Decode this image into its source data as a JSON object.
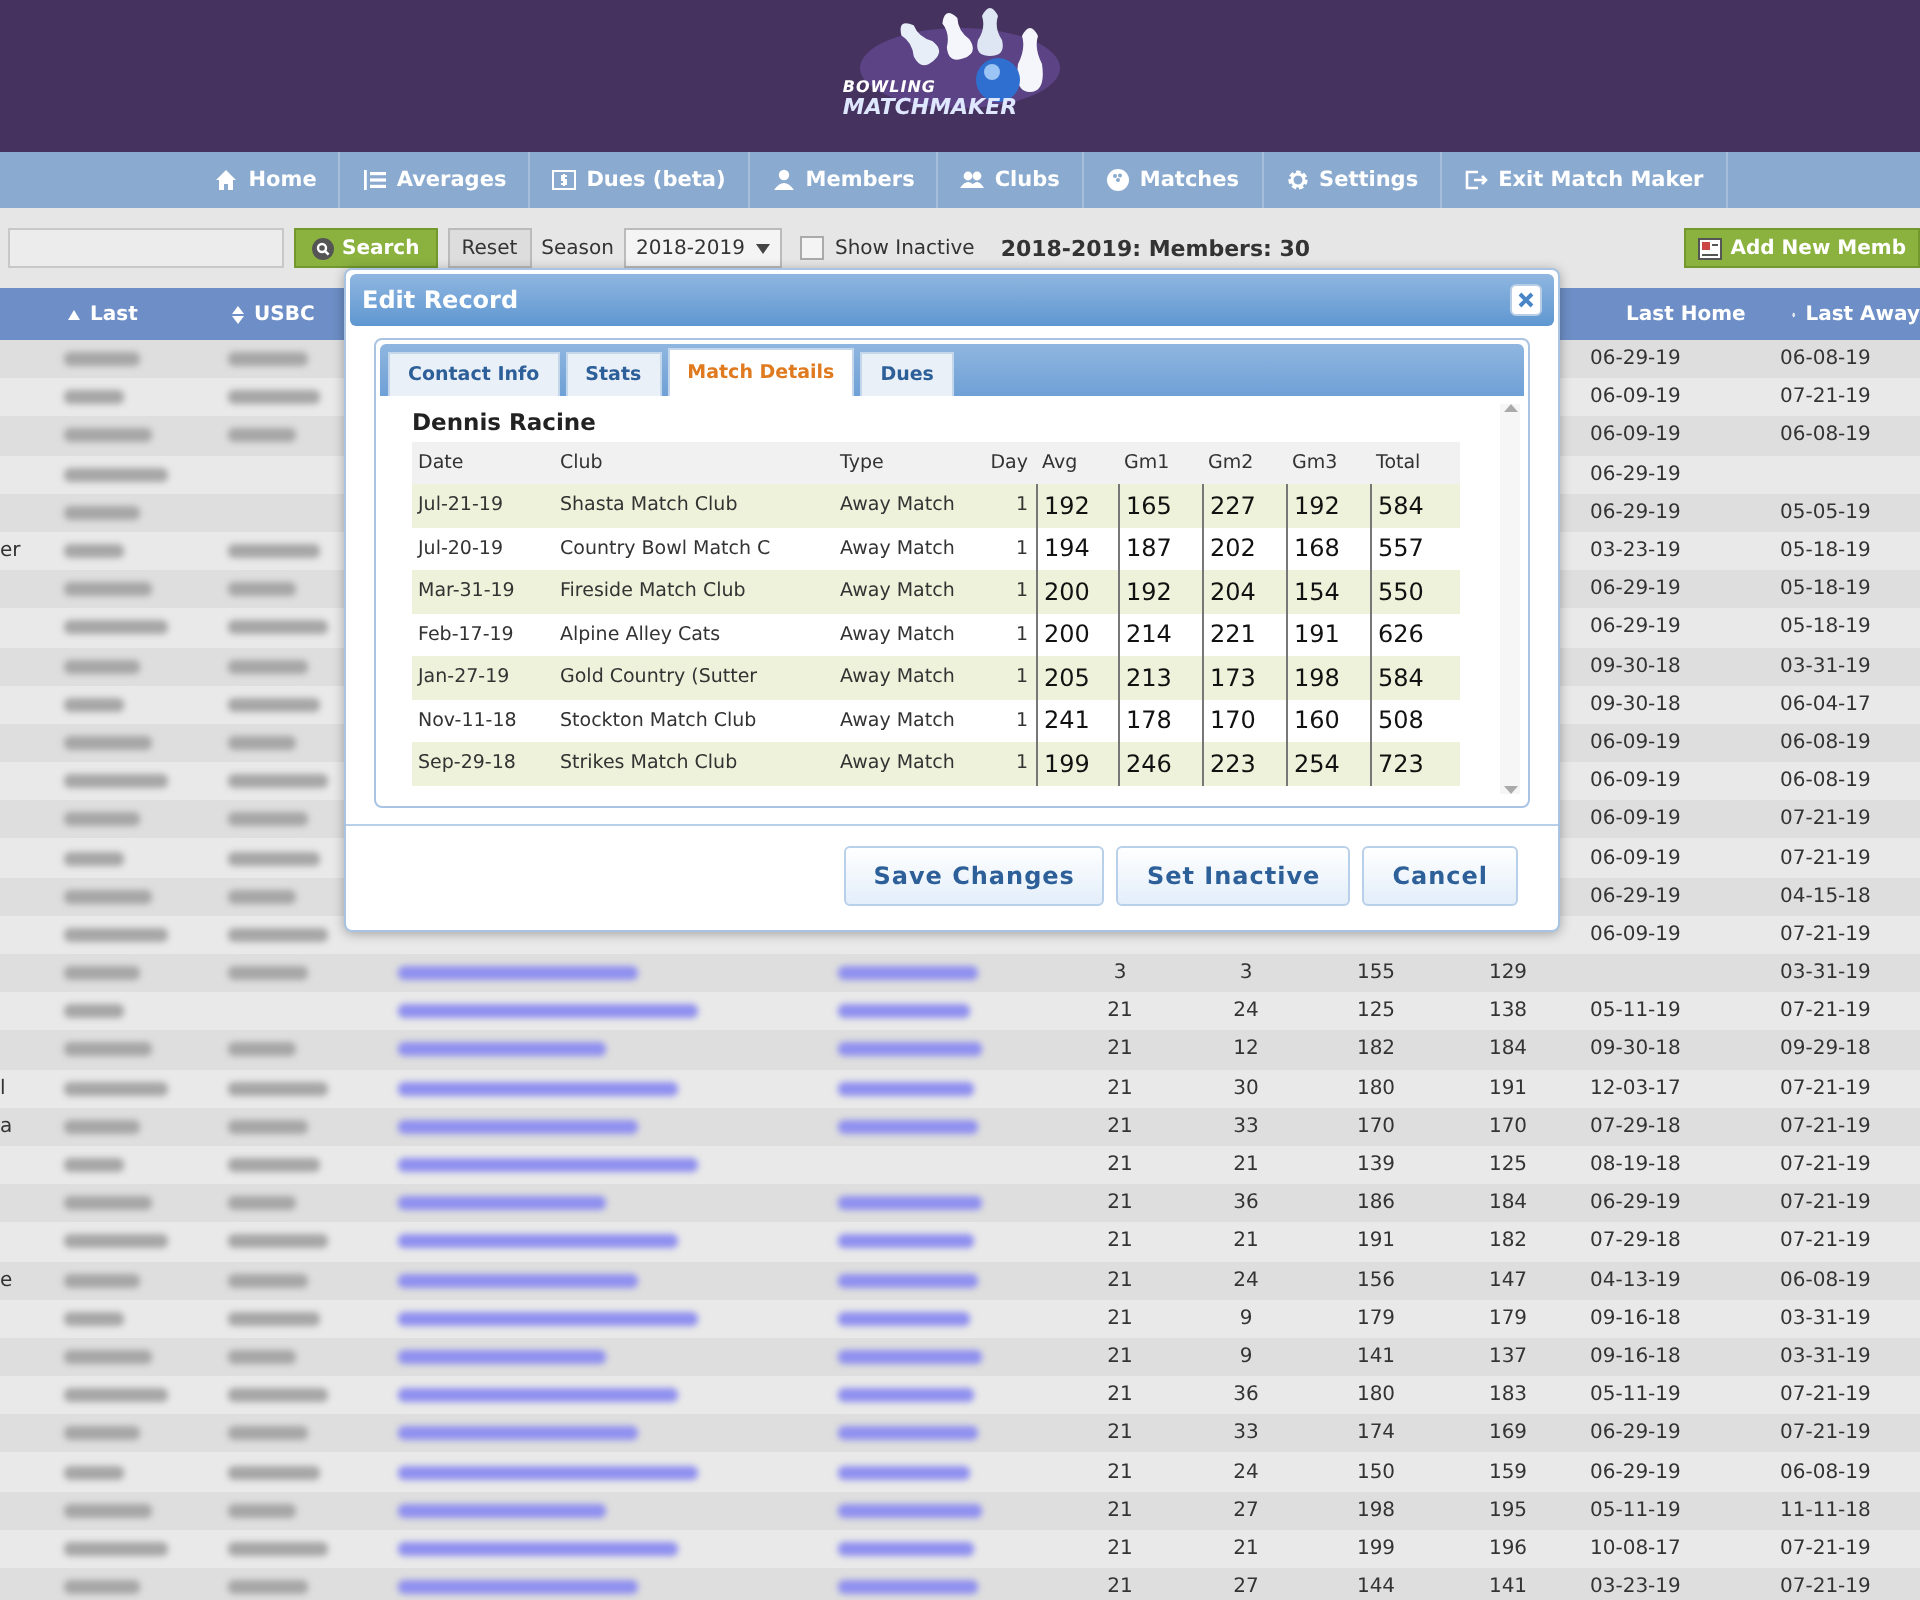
{
  "logo": {
    "line_1": "BOWLING",
    "line_2": "MATCHMAKER"
  },
  "nav": [
    {
      "label": "Home"
    },
    {
      "label": "Averages"
    },
    {
      "label": "Dues (beta)"
    },
    {
      "label": "Members"
    },
    {
      "label": "Clubs"
    },
    {
      "label": "Matches"
    },
    {
      "label": "Settings"
    },
    {
      "label": "Exit Match Maker"
    }
  ],
  "toolbar": {
    "search_button": "Search",
    "reset_button": "Reset",
    "season_label": "Season",
    "season_select": "2018-2019",
    "show_inactive": {
      "label": "Show Inactive",
      "checked": false
    },
    "summary": "2018-2019: Members: 30",
    "add_button": "Add New Memb"
  },
  "table": {
    "headers": {
      "last": "Last",
      "usbc": "USBC",
      "last_home": "Last Home",
      "last_away": "Last Away"
    },
    "rows": [
      {
        "blur_last": true,
        "blur_usbc": true,
        "blur_email": false,
        "blur_phone": false,
        "last_home": "06-29-19",
        "last_away": "06-08-19"
      },
      {
        "blur_last": true,
        "blur_usbc": true,
        "blur_email": false,
        "blur_phone": false,
        "last_home": "06-09-19",
        "last_away": "07-21-19"
      },
      {
        "blur_last": true,
        "blur_usbc": true,
        "blur_email": false,
        "blur_phone": false,
        "last_home": "06-09-19",
        "last_away": "06-08-19"
      },
      {
        "blur_last": true,
        "blur_usbc": false,
        "blur_email": false,
        "blur_phone": false,
        "last_home": "06-29-19"
      },
      {
        "blur_last": true,
        "blur_usbc": false,
        "blur_email": false,
        "blur_phone": false,
        "last_home": "06-29-19",
        "last_away": "05-05-19"
      },
      {
        "first": "er",
        "blur_last": true,
        "blur_usbc": true,
        "blur_email": false,
        "blur_phone": false,
        "last_home": "03-23-19",
        "last_away": "05-18-19"
      },
      {
        "blur_last": true,
        "blur_usbc": true,
        "blur_email": false,
        "blur_phone": false,
        "last_home": "06-29-19",
        "last_away": "05-18-19"
      },
      {
        "blur_last": true,
        "blur_usbc": true,
        "blur_email": false,
        "blur_phone": false,
        "last_home": "06-29-19",
        "last_away": "05-18-19"
      },
      {
        "blur_last": true,
        "blur_usbc": true,
        "blur_email": false,
        "blur_phone": false,
        "last_home": "09-30-18",
        "last_away": "03-31-19"
      },
      {
        "blur_last": true,
        "blur_usbc": true,
        "blur_email": false,
        "blur_phone": false,
        "last_home": "09-30-18",
        "last_away": "06-04-17"
      },
      {
        "blur_last": true,
        "blur_usbc": true,
        "blur_email": false,
        "blur_phone": false,
        "last_home": "06-09-19",
        "last_away": "06-08-19"
      },
      {
        "blur_last": true,
        "blur_usbc": true,
        "blur_email": false,
        "blur_phone": false,
        "last_home": "06-09-19",
        "last_away": "06-08-19"
      },
      {
        "blur_last": true,
        "blur_usbc": true,
        "blur_email": false,
        "blur_phone": false,
        "last_home": "06-09-19",
        "last_away": "07-21-19"
      },
      {
        "blur_last": true,
        "blur_usbc": true,
        "blur_email": false,
        "blur_phone": false,
        "last_home": "06-09-19",
        "last_away": "07-21-19"
      },
      {
        "blur_last": true,
        "blur_usbc": true,
        "blur_email": false,
        "blur_phone": false,
        "last_home": "06-29-19",
        "last_away": "04-15-18"
      },
      {
        "blur_last": true,
        "blur_usbc": true,
        "blur_email": false,
        "blur_phone": false,
        "last_home": "06-09-19",
        "last_away": "07-21-19"
      },
      {
        "blur_last": true,
        "blur_usbc": true,
        "blur_email": true,
        "blur_phone": true,
        "column_6": "3",
        "column_7": "3",
        "column_8": "155",
        "column_9": "129",
        "last_away": "03-31-19"
      },
      {
        "blur_last": true,
        "blur_usbc": false,
        "blur_email": true,
        "blur_phone": true,
        "column_6": "21",
        "column_7": "24",
        "column_8": "125",
        "column_9": "138",
        "last_home": "05-11-19",
        "last_away": "07-21-19"
      },
      {
        "blur_last": true,
        "blur_usbc": true,
        "blur_email": true,
        "blur_phone": true,
        "column_6": "21",
        "column_7": "12",
        "column_8": "182",
        "column_9": "184",
        "last_home": "09-30-18",
        "last_away": "09-29-18"
      },
      {
        "first": "l",
        "blur_last": true,
        "blur_usbc": true,
        "blur_email": true,
        "blur_phone": true,
        "column_6": "21",
        "column_7": "30",
        "column_8": "180",
        "column_9": "191",
        "last_home": "12-03-17",
        "last_away": "07-21-19"
      },
      {
        "first": "a",
        "blur_last": true,
        "blur_usbc": true,
        "blur_email": true,
        "blur_phone": true,
        "column_6": "21",
        "column_7": "33",
        "column_8": "170",
        "column_9": "170",
        "last_home": "07-29-18",
        "last_away": "07-21-19"
      },
      {
        "blur_last": true,
        "blur_usbc": true,
        "blur_email": true,
        "blur_phone": false,
        "column_6": "21",
        "column_7": "21",
        "column_8": "139",
        "column_9": "125",
        "last_home": "08-19-18",
        "last_away": "07-21-19"
      },
      {
        "blur_last": true,
        "blur_usbc": true,
        "blur_email": true,
        "blur_phone": true,
        "column_6": "21",
        "column_7": "36",
        "column_8": "186",
        "column_9": "184",
        "last_home": "06-29-19",
        "last_away": "07-21-19"
      },
      {
        "blur_last": true,
        "blur_usbc": true,
        "blur_email": true,
        "blur_phone": true,
        "column_6": "21",
        "column_7": "21",
        "column_8": "191",
        "column_9": "182",
        "last_home": "07-29-18",
        "last_away": "07-21-19"
      },
      {
        "first": "e",
        "blur_last": true,
        "blur_usbc": true,
        "blur_email": true,
        "blur_phone": true,
        "column_6": "21",
        "column_7": "24",
        "column_8": "156",
        "column_9": "147",
        "last_home": "04-13-19",
        "last_away": "06-08-19"
      },
      {
        "blur_last": true,
        "blur_usbc": true,
        "blur_email": true,
        "blur_phone": true,
        "column_6": "21",
        "column_7": "9",
        "column_8": "179",
        "column_9": "179",
        "last_home": "09-16-18",
        "last_away": "03-31-19"
      },
      {
        "blur_last": true,
        "blur_usbc": true,
        "blur_email": true,
        "blur_phone": true,
        "column_6": "21",
        "column_7": "9",
        "column_8": "141",
        "column_9": "137",
        "last_home": "09-16-18",
        "last_away": "03-31-19"
      },
      {
        "blur_last": true,
        "blur_usbc": true,
        "blur_email": true,
        "blur_phone": true,
        "column_6": "21",
        "column_7": "36",
        "column_8": "180",
        "column_9": "183",
        "last_home": "05-11-19",
        "last_away": "07-21-19"
      },
      {
        "blur_last": true,
        "blur_usbc": true,
        "blur_email": true,
        "blur_phone": true,
        "column_6": "21",
        "column_7": "33",
        "column_8": "174",
        "column_9": "169",
        "last_home": "06-29-19",
        "last_away": "07-21-19"
      },
      {
        "blur_last": true,
        "blur_usbc": true,
        "blur_email": true,
        "blur_phone": true,
        "column_6": "21",
        "column_7": "24",
        "column_8": "150",
        "column_9": "159",
        "last_home": "06-29-19",
        "last_away": "06-08-19"
      },
      {
        "blur_last": true,
        "blur_usbc": true,
        "blur_email": true,
        "blur_phone": true,
        "column_6": "21",
        "column_7": "27",
        "column_8": "198",
        "column_9": "195",
        "last_home": "05-11-19",
        "last_away": "11-11-18"
      },
      {
        "blur_last": true,
        "blur_usbc": true,
        "blur_email": true,
        "blur_phone": true,
        "column_6": "21",
        "column_7": "21",
        "column_8": "199",
        "column_9": "196",
        "last_home": "10-08-17",
        "last_away": "07-21-19"
      },
      {
        "blur_last": true,
        "blur_usbc": true,
        "blur_email": true,
        "blur_phone": true,
        "column_6": "21",
        "column_7": "27",
        "column_8": "144",
        "column_9": "141",
        "last_home": "03-23-19",
        "last_away": "07-21-19"
      }
    ]
  },
  "modal": {
    "title": "Edit Record",
    "tabs": [
      {
        "label": "Contact Info",
        "selected": false
      },
      {
        "label": "Stats",
        "selected": false
      },
      {
        "label": "Match Details",
        "selected": true
      },
      {
        "label": "Dues",
        "selected": false
      }
    ],
    "member_name": "Dennis Racine",
    "columns": [
      "Date",
      "Club",
      "Type",
      "Day",
      "Avg",
      "Gm1",
      "Gm2",
      "Gm3",
      "Total"
    ],
    "rows": [
      {
        "date": "Jul-21-19",
        "club": "Shasta Match Club",
        "type": "Away Match",
        "day": "1",
        "avg": "192",
        "gm1": "165",
        "gm2": "227",
        "gm3": "192",
        "total": "584"
      },
      {
        "date": "Jul-20-19",
        "club": "Country Bowl Match C",
        "type": "Away Match",
        "day": "1",
        "avg": "194",
        "gm1": "187",
        "gm2": "202",
        "gm3": "168",
        "total": "557"
      },
      {
        "date": "Mar-31-19",
        "club": "Fireside Match Club",
        "type": "Away Match",
        "day": "1",
        "avg": "200",
        "gm1": "192",
        "gm2": "204",
        "gm3": "154",
        "total": "550"
      },
      {
        "date": "Feb-17-19",
        "club": "Alpine Alley Cats",
        "type": "Away Match",
        "day": "1",
        "avg": "200",
        "gm1": "214",
        "gm2": "221",
        "gm3": "191",
        "total": "626"
      },
      {
        "date": "Jan-27-19",
        "club": "Gold Country (Sutter",
        "type": "Away Match",
        "day": "1",
        "avg": "205",
        "gm1": "213",
        "gm2": "173",
        "gm3": "198",
        "total": "584"
      },
      {
        "date": "Nov-11-18",
        "club": "Stockton Match Club",
        "type": "Away Match",
        "day": "1",
        "avg": "241",
        "gm1": "178",
        "gm2": "170",
        "gm3": "160",
        "total": "508"
      },
      {
        "date": "Sep-29-18",
        "club": "Strikes Match Club",
        "type": "Away Match",
        "day": "1",
        "avg": "199",
        "gm1": "246",
        "gm2": "223",
        "gm3": "254",
        "total": "723"
      }
    ],
    "buttons": [
      "Save Changes",
      "Set Inactive",
      "Cancel"
    ]
  }
}
